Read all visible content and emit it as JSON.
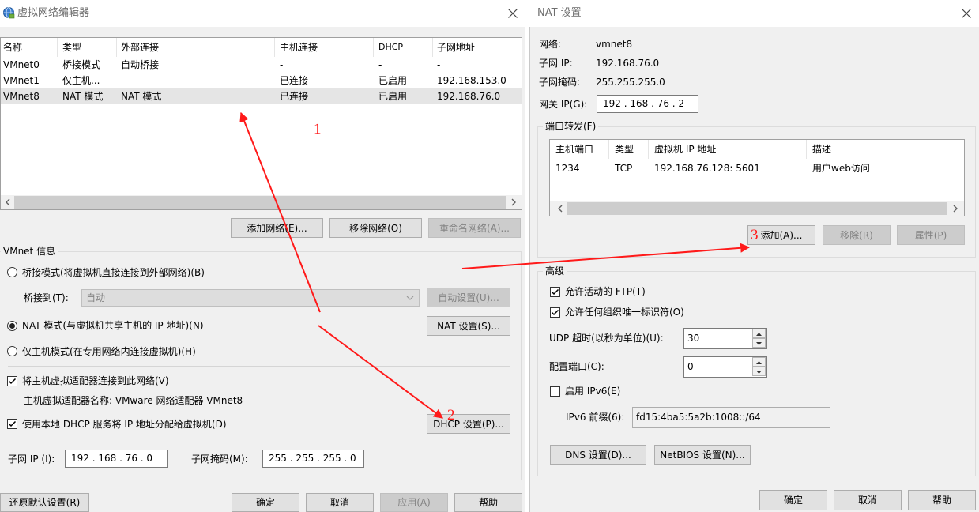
{
  "colors": {
    "dialog_bg": "#f0f0f0",
    "selection": "#e5e5e5",
    "annotation": "#ff1a1a"
  },
  "icons": {
    "app": "network-globe-icon",
    "close": "close-icon",
    "scroll_left": "chevron-left-icon",
    "scroll_right": "chevron-right-icon",
    "dropdown": "chevron-down-icon",
    "spin_up": "spin-up-icon",
    "spin_down": "spin-down-icon",
    "check": "checkmark-icon"
  },
  "editor": {
    "title": "虚拟网络编辑器",
    "table": {
      "columns": [
        "名称",
        "类型",
        "外部连接",
        "主机连接",
        "DHCP",
        "子网地址"
      ],
      "rows": [
        [
          "VMnet0",
          "桥接模式",
          "自动桥接",
          "-",
          "-",
          "-"
        ],
        [
          "VMnet1",
          "仅主机...",
          "-",
          "已连接",
          "已启用",
          "192.168.153.0"
        ],
        [
          "VMnet8",
          "NAT 模式",
          "NAT 模式",
          "已连接",
          "已启用",
          "192.168.76.0"
        ]
      ],
      "selected_row": 2
    },
    "add_network": "添加网络(E)...",
    "remove_network": "移除网络(O)",
    "rename_network": "重命名网络(A)...",
    "info": {
      "group_label": "VMnet 信息",
      "bridged": {
        "label": "桥接模式(将虚拟机直接连接到外部网络)(B)",
        "checked": false
      },
      "bridge_to_label": "桥接到(T):",
      "bridge_to_value": "自动",
      "auto_settings": "自动设置(U)...",
      "nat": {
        "label": "NAT 模式(与虚拟机共享主机的 IP 地址)(N)",
        "checked": true
      },
      "nat_settings": "NAT 设置(S)...",
      "host_only": {
        "label": "仅主机模式(在专用网络内连接虚拟机)(H)",
        "checked": false
      },
      "connect_adapter": {
        "label": "将主机虚拟适配器连接到此网络(V)",
        "checked": true
      },
      "adapter_name": "主机虚拟适配器名称: VMware 网络适配器 VMnet8",
      "use_dhcp": {
        "label": "使用本地 DHCP 服务将 IP 地址分配给虚拟机(D)",
        "checked": true
      },
      "dhcp_settings": "DHCP 设置(P)...",
      "subnet_ip_label": "子网 IP (I):",
      "subnet_ip": "192 . 168 . 76 . 0",
      "subnet_mask_label": "子网掩码(M):",
      "subnet_mask": "255 . 255 . 255 . 0"
    },
    "restore_defaults": "还原默认设置(R)",
    "ok": "确定",
    "cancel": "取消",
    "apply": "应用(A)",
    "help": "帮助"
  },
  "nat": {
    "title": "NAT 设置",
    "network_label": "网络:",
    "network": "vmnet8",
    "subnet_ip_label": "子网 IP:",
    "subnet_ip": "192.168.76.0",
    "subnet_mask_label": "子网掩码:",
    "subnet_mask": "255.255.255.0",
    "gateway_label": "网关 IP(G):",
    "gateway": "192 . 168 . 76 . 2",
    "port_forwarding": {
      "group_label": "端口转发(F)",
      "columns": [
        "主机端口",
        "类型",
        "虚拟机 IP 地址",
        "描述"
      ],
      "rows": [
        [
          "1234",
          "TCP",
          "192.168.76.128: 5601",
          "用户web访问"
        ]
      ],
      "add": "添加(A)...",
      "remove": "移除(R)",
      "properties": "属性(P)"
    },
    "advanced": {
      "group_label": "高级",
      "allow_ftp": {
        "label": "允许活动的 FTP(T)",
        "checked": true
      },
      "allow_oui": {
        "label": "允许任何组织唯一标识符(O)",
        "checked": true
      },
      "udp_timeout_label": "UDP 超时(以秒为单位)(U):",
      "udp_timeout": "30",
      "config_port_label": "配置端口(C):",
      "config_port": "0",
      "enable_ipv6": {
        "label": "启用 IPv6(E)",
        "checked": false
      },
      "ipv6_prefix_label": "IPv6 前缀(6):",
      "ipv6_prefix": "fd15:4ba5:5a2b:1008::/64",
      "dns_settings": "DNS 设置(D)...",
      "netbios_settings": "NetBIOS 设置(N)..."
    },
    "ok": "确定",
    "cancel": "取消",
    "help": "帮助"
  },
  "annotations": {
    "step1": "1",
    "step2": "2",
    "step3": "3"
  }
}
